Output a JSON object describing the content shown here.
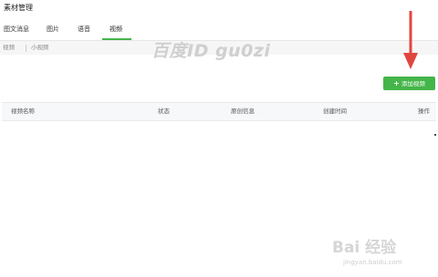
{
  "page": {
    "title": "素材管理"
  },
  "tabs": [
    {
      "label": "图文消息"
    },
    {
      "label": "图片"
    },
    {
      "label": "语音"
    },
    {
      "label": "视频"
    }
  ],
  "active_tab": "视频",
  "subnav": {
    "items": [
      {
        "label": "视频"
      },
      {
        "label": "小视频"
      }
    ]
  },
  "overlay": {
    "watermark_text": "百度ID gu0zi",
    "arrow_color": "#e0463f",
    "brand_main": "Bai 经验",
    "brand_sub": "jingyan.baidu.com"
  },
  "toolbar": {
    "add_video_label": "添加视频",
    "accent_color": "#44b549"
  },
  "table": {
    "columns": [
      {
        "label": "视频名称"
      },
      {
        "label": "状态"
      },
      {
        "label": "原创信息"
      },
      {
        "label": "创建时间"
      },
      {
        "label": "操作"
      }
    ],
    "rows": []
  },
  "icons": {
    "add": "plus-icon",
    "arrow": "arrow-down-icon"
  }
}
